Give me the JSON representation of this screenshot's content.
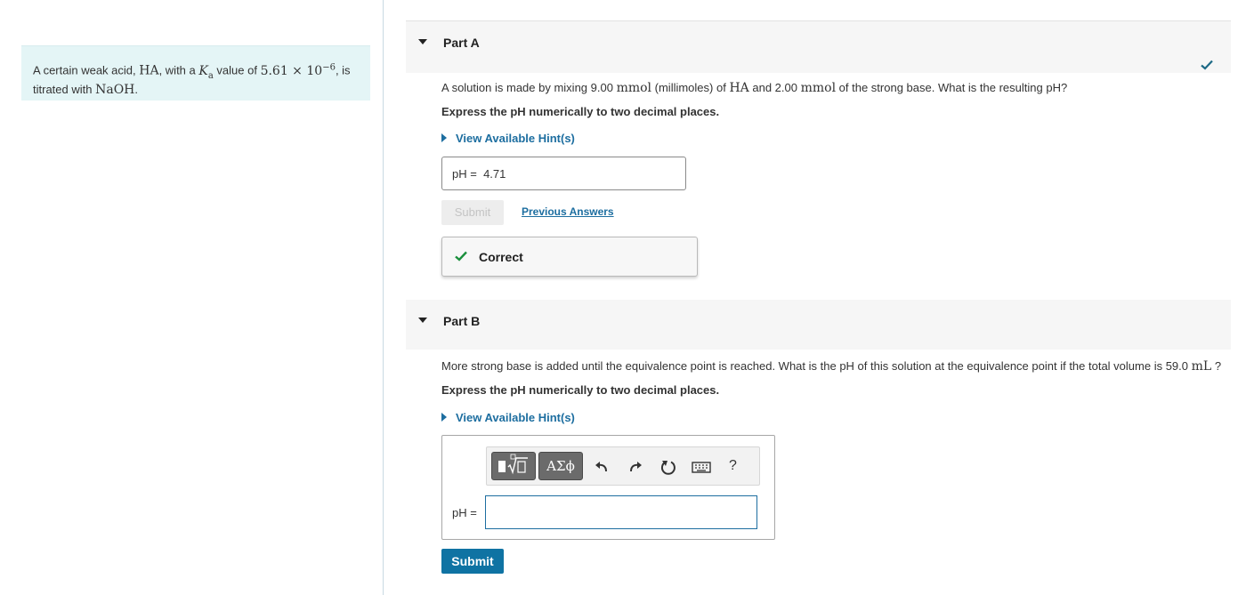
{
  "intro": {
    "t1": "A certain weak acid, ",
    "acid": "HA",
    "t2": ", with a ",
    "ka_symbol": "K",
    "ka_sub": "a",
    "t3": " value of ",
    "ka_value": "5.61 × 10",
    "ka_exp": "−6",
    "t4": ", is",
    "t5": "titrated with ",
    "base": "NaOH",
    "t6": "."
  },
  "part_a": {
    "title": "Part A",
    "q": {
      "t1": "A solution is made by mixing 9.00 ",
      "u1": "mmol",
      "t2": " (millimoles) of ",
      "acid": "HA",
      "t3": " and 2.00 ",
      "u2": "mmol",
      "t4": " of the strong base. What is the resulting pH?"
    },
    "instruction": "Express the pH numerically to two decimal places.",
    "hint": "View Available Hint(s)",
    "answer_label": "pH =",
    "answer_value": "4.71",
    "submit": "Submit",
    "previous": "Previous Answers",
    "feedback": "Correct",
    "status_color": "#1a8f3c"
  },
  "part_b": {
    "title": "Part B",
    "q": {
      "t1": "More strong base is added until the equivalence point is reached. What is the pH of this solution at the equivalence point if the total volume is 59.0 ",
      "unit": "mL",
      "t2": " ?"
    },
    "instruction": "Express the pH numerically to two decimal places.",
    "hint": "View Available Hint(s)",
    "toolbar": {
      "greek": "ΑΣϕ",
      "help": "?"
    },
    "answer_label": "pH =",
    "submit": "Submit"
  },
  "colors": {
    "link": "#1d6ea0",
    "primary_button": "#0f73a3",
    "intro_bg": "#e4f5f6"
  }
}
